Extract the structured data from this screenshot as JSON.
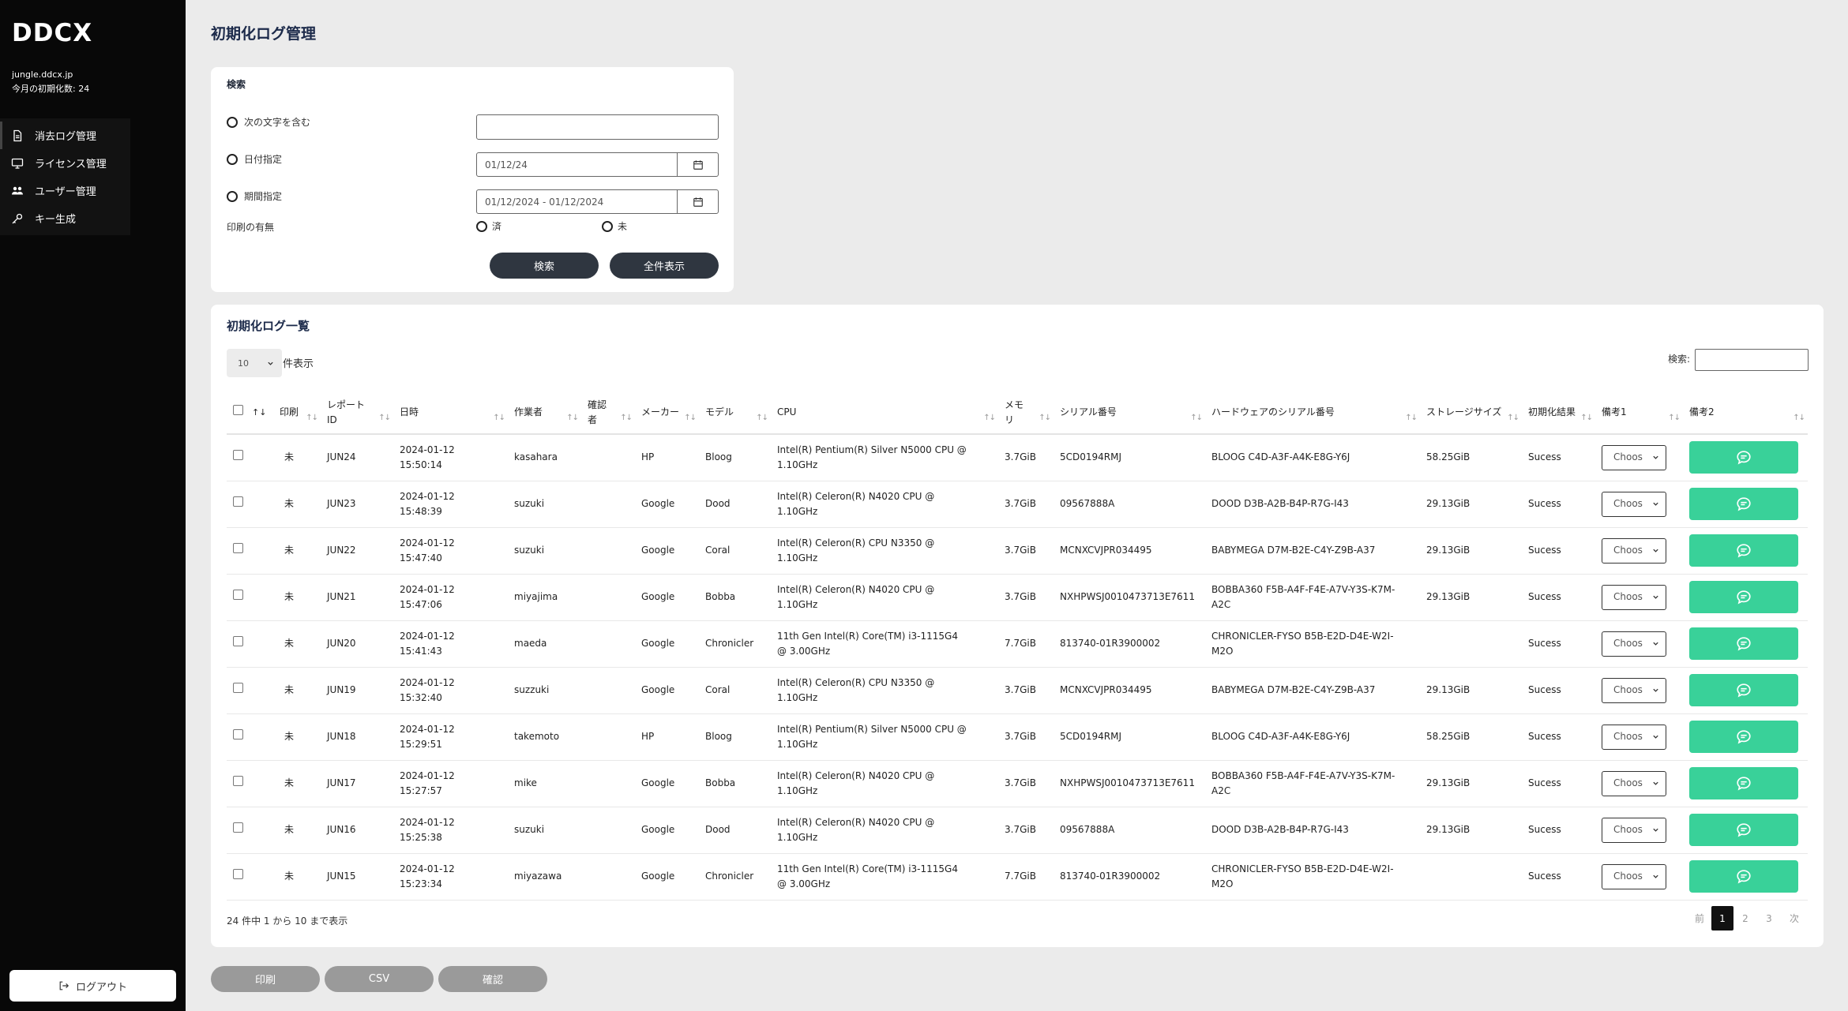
{
  "sidebar": {
    "logo": "DDCX",
    "domain": "jungle.ddcx.jp",
    "monthly_count": "今月の初期化数: 24",
    "items": [
      {
        "label": "消去ログ管理",
        "icon": "document-icon"
      },
      {
        "label": "ライセンス管理",
        "icon": "monitor-icon"
      },
      {
        "label": "ユーザー管理",
        "icon": "users-icon"
      },
      {
        "label": "キー生成",
        "icon": "key-icon"
      }
    ],
    "logout_label": "ログアウト"
  },
  "page": {
    "title": "初期化ログ管理"
  },
  "search": {
    "title": "検索",
    "opt_contains": "次の文字を含む",
    "opt_date": "日付指定",
    "opt_range": "期間指定",
    "date_value": "01/12/24",
    "range_value": "01/12/2024 - 01/12/2024",
    "print_label": "印刷の有無",
    "print_done": "済",
    "print_not": "未",
    "search_button": "検索",
    "show_all_button": "全件表示"
  },
  "list": {
    "title": "初期化ログ一覧",
    "page_size": "10",
    "page_size_suffix": "件表示",
    "search_label": "検索:",
    "sort_icon": "↑↓",
    "columns": [
      "印刷",
      "レポートID",
      "日時",
      "作業者",
      "確認者",
      "メーカー",
      "モデル",
      "CPU",
      "メモリ",
      "シリアル番号",
      "ハードウェアのシリアル番号",
      "ストレージサイズ",
      "初期化結果",
      "備考1",
      "備考2"
    ],
    "select_placeholder": "Choos",
    "rows": [
      {
        "print": "未",
        "id": "JUN24",
        "date": "2024-01-12",
        "time": "15:50:14",
        "worker": "kasahara",
        "checker": "",
        "maker": "HP",
        "model": "Bloog",
        "cpu": "Intel(R) Pentium(R) Silver N5000 CPU @ 1.10GHz",
        "mem": "3.7GiB",
        "serial": "5CD0194RMJ",
        "hw": "BLOOG C4D-A3F-A4K-E8G-Y6J",
        "storage": "58.25GiB",
        "result": "Sucess"
      },
      {
        "print": "未",
        "id": "JUN23",
        "date": "2024-01-12",
        "time": "15:48:39",
        "worker": "suzuki",
        "checker": "",
        "maker": "Google",
        "model": "Dood",
        "cpu": "Intel(R) Celeron(R) N4020 CPU @ 1.10GHz",
        "mem": "3.7GiB",
        "serial": "09567888A",
        "hw": "DOOD D3B-A2B-B4P-R7G-I43",
        "storage": "29.13GiB",
        "result": "Sucess"
      },
      {
        "print": "未",
        "id": "JUN22",
        "date": "2024-01-12",
        "time": "15:47:40",
        "worker": "suzuki",
        "checker": "",
        "maker": "Google",
        "model": "Coral",
        "cpu": "Intel(R) Celeron(R) CPU N3350 @ 1.10GHz",
        "mem": "3.7GiB",
        "serial": "MCNXCVJPR034495",
        "hw": "BABYMEGA D7M-B2E-C4Y-Z9B-A37",
        "storage": "29.13GiB",
        "result": "Sucess"
      },
      {
        "print": "未",
        "id": "JUN21",
        "date": "2024-01-12",
        "time": "15:47:06",
        "worker": "miyajima",
        "checker": "",
        "maker": "Google",
        "model": "Bobba",
        "cpu": "Intel(R) Celeron(R) N4020 CPU @ 1.10GHz",
        "mem": "3.7GiB",
        "serial": "NXHPWSJ0010473713E7611",
        "hw": "BOBBA360 F5B-A4F-F4E-A7V-Y3S-K7M-A2C",
        "storage": "29.13GiB",
        "result": "Sucess"
      },
      {
        "print": "未",
        "id": "JUN20",
        "date": "2024-01-12",
        "time": "15:41:43",
        "worker": "maeda",
        "checker": "",
        "maker": "Google",
        "model": "Chronicler",
        "cpu": "11th Gen Intel(R) Core(TM) i3-1115G4 @ 3.00GHz",
        "mem": "7.7GiB",
        "serial": "813740-01R3900002",
        "hw": "CHRONICLER-FYSO B5B-E2D-D4E-W2I-M2O",
        "storage": "",
        "result": "Sucess"
      },
      {
        "print": "未",
        "id": "JUN19",
        "date": "2024-01-12",
        "time": "15:32:40",
        "worker": "suzzuki",
        "checker": "",
        "maker": "Google",
        "model": "Coral",
        "cpu": "Intel(R) Celeron(R) CPU N3350 @ 1.10GHz",
        "mem": "3.7GiB",
        "serial": "MCNXCVJPR034495",
        "hw": "BABYMEGA D7M-B2E-C4Y-Z9B-A37",
        "storage": "29.13GiB",
        "result": "Sucess"
      },
      {
        "print": "未",
        "id": "JUN18",
        "date": "2024-01-12",
        "time": "15:29:51",
        "worker": "takemoto",
        "checker": "",
        "maker": "HP",
        "model": "Bloog",
        "cpu": "Intel(R) Pentium(R) Silver N5000 CPU @ 1.10GHz",
        "mem": "3.7GiB",
        "serial": "5CD0194RMJ",
        "hw": "BLOOG C4D-A3F-A4K-E8G-Y6J",
        "storage": "58.25GiB",
        "result": "Sucess"
      },
      {
        "print": "未",
        "id": "JUN17",
        "date": "2024-01-12",
        "time": "15:27:57",
        "worker": "mike",
        "checker": "",
        "maker": "Google",
        "model": "Bobba",
        "cpu": "Intel(R) Celeron(R) N4020 CPU @ 1.10GHz",
        "mem": "3.7GiB",
        "serial": "NXHPWSJ0010473713E7611",
        "hw": "BOBBA360 F5B-A4F-F4E-A7V-Y3S-K7M-A2C",
        "storage": "29.13GiB",
        "result": "Sucess"
      },
      {
        "print": "未",
        "id": "JUN16",
        "date": "2024-01-12",
        "time": "15:25:38",
        "worker": "suzuki",
        "checker": "",
        "maker": "Google",
        "model": "Dood",
        "cpu": "Intel(R) Celeron(R) N4020 CPU @ 1.10GHz",
        "mem": "3.7GiB",
        "serial": "09567888A",
        "hw": "DOOD D3B-A2B-B4P-R7G-I43",
        "storage": "29.13GiB",
        "result": "Sucess"
      },
      {
        "print": "未",
        "id": "JUN15",
        "date": "2024-01-12",
        "time": "15:23:34",
        "worker": "miyazawa",
        "checker": "",
        "maker": "Google",
        "model": "Chronicler",
        "cpu": "11th Gen Intel(R) Core(TM) i3-1115G4 @ 3.00GHz",
        "mem": "7.7GiB",
        "serial": "813740-01R3900002",
        "hw": "CHRONICLER-FYSO B5B-E2D-D4E-W2I-M2O",
        "storage": "",
        "result": "Sucess"
      }
    ],
    "info": "24 件中 1 から 10 まで表示",
    "pager": {
      "prev": "前",
      "pages": [
        "1",
        "2",
        "3"
      ],
      "current": "1",
      "next": "次"
    }
  },
  "footer_buttons": [
    "印刷",
    "CSV",
    "確認"
  ],
  "colors": {
    "sidebar_bg": "#080808",
    "memo_green": "#39d199",
    "dark_button": "#2f3640",
    "gray_button": "#9a9a9a"
  }
}
